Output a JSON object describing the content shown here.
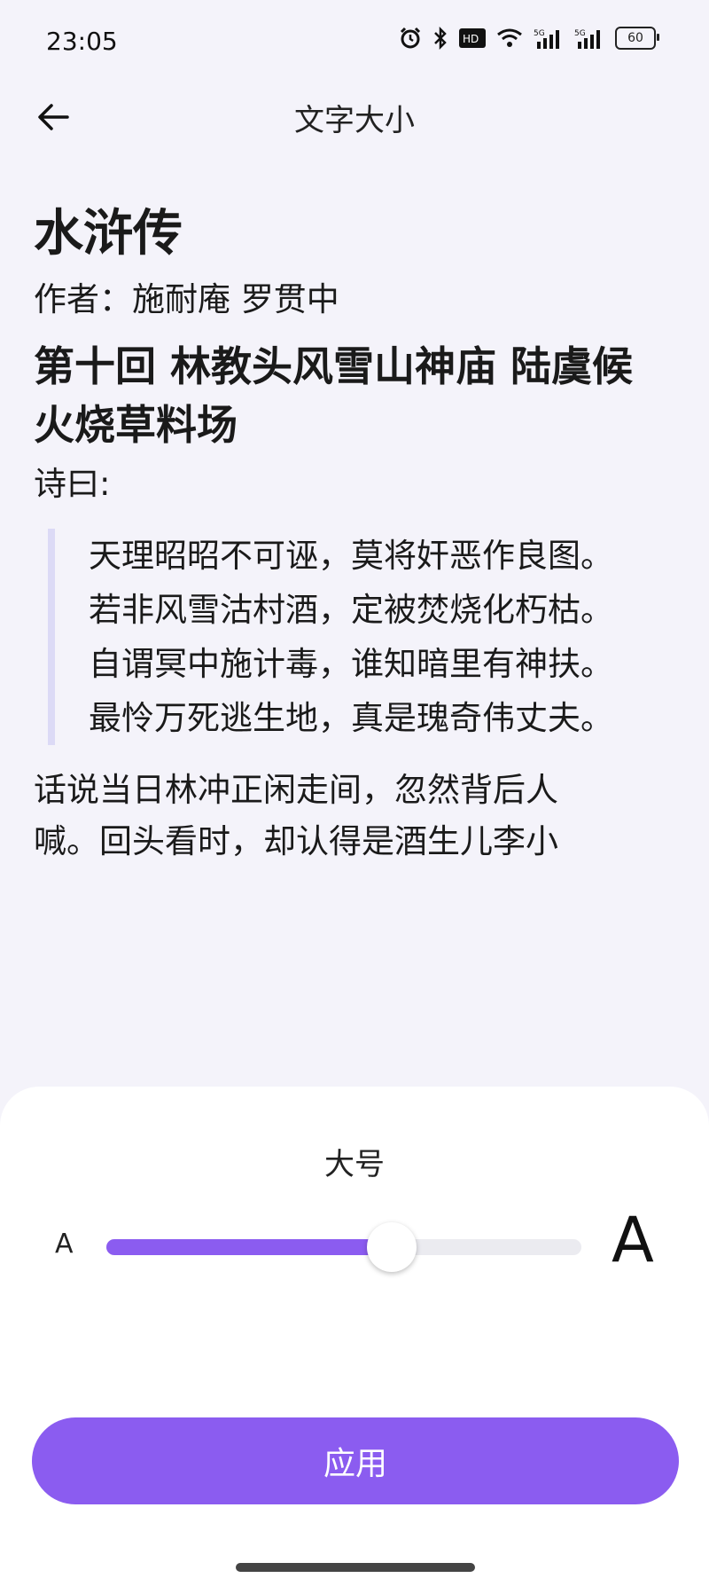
{
  "status_bar": {
    "time": "23:05",
    "battery": "60",
    "icons": [
      "alarm-icon",
      "bluetooth-icon",
      "hd-icon",
      "wifi-icon",
      "signal-5g-icon",
      "signal-5g-icon",
      "battery-icon"
    ]
  },
  "app_bar": {
    "title": "文字大小",
    "back_icon": "arrow-left-icon"
  },
  "preview": {
    "book_title": "水浒传",
    "author": "作者：施耐庵 罗贯中",
    "chapter_title": "第十回 林教头风雪山神庙 陆虞候火烧草料场",
    "intro": "诗曰:",
    "poem_lines": [
      "天理昭昭不可诬，莫将奸恶作良图。",
      "若非风雪沽村酒，定被焚烧化朽枯。",
      "自谓冥中施计毒，谁知暗里有神扶。",
      "最怜万死逃生地，真是瑰奇伟丈夫。"
    ],
    "paragraph": "话说当日林冲正闲走间，忽然背后人喊。回头看时，却认得是酒生儿李小"
  },
  "size_sheet": {
    "current_size_label": "大号",
    "small_label": "A",
    "large_label": "A",
    "slider_level": 0.6,
    "apply_label": "应用"
  },
  "colors": {
    "accent": "#8b5cf0",
    "background": "#f4f3fa",
    "quote_bar": "#dcdaf6"
  }
}
